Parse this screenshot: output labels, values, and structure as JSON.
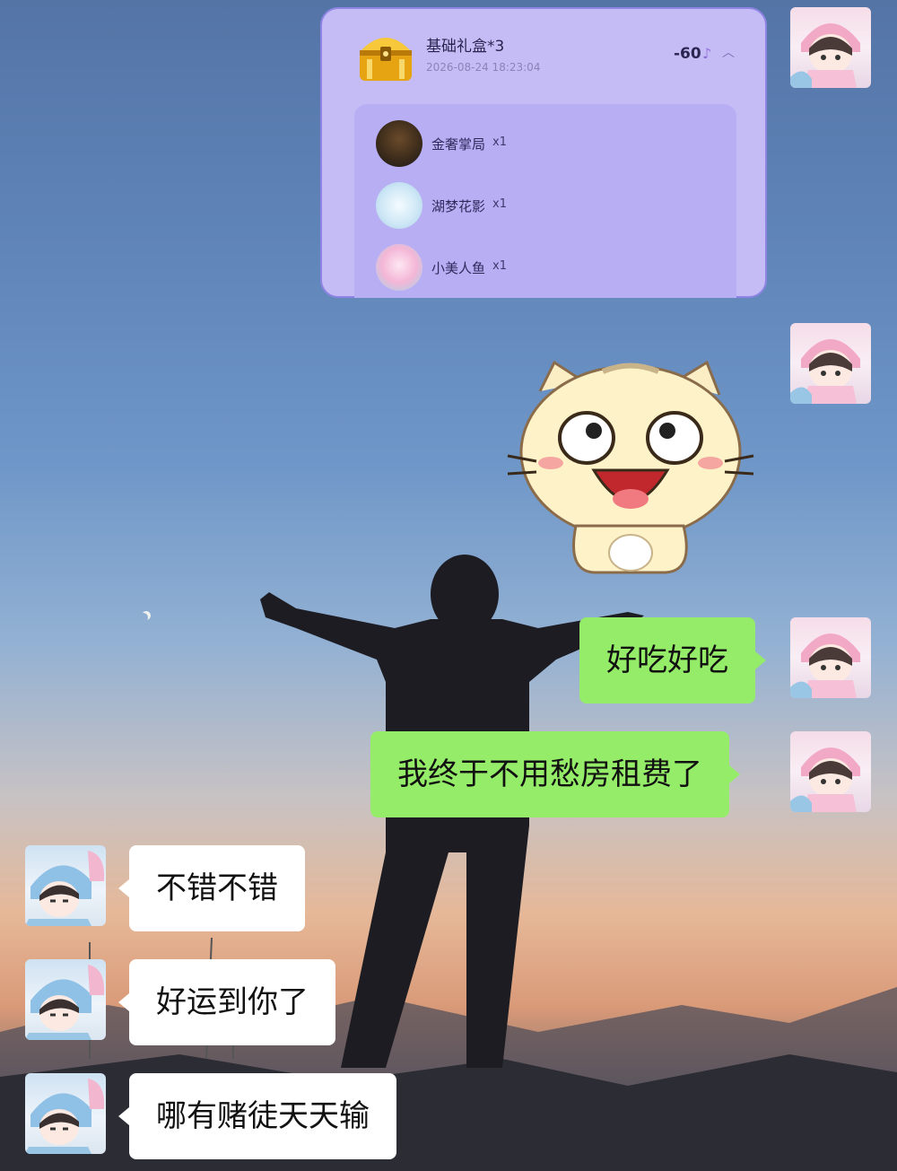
{
  "gift_card": {
    "title": "基础礼盒*3",
    "timestamp": "2026-08-24 18:23:04",
    "cost": "-60",
    "icon": "treasure-chest-icon",
    "items": [
      {
        "name": "金奢掌局",
        "qty": "x1"
      },
      {
        "name": "湖梦花影",
        "qty": "x1"
      },
      {
        "name": "小美人鱼",
        "qty": "x1"
      }
    ]
  },
  "sticker": "cat-laughing-sticker",
  "messages_sent": [
    {
      "text": "好吃好吃"
    },
    {
      "text": "我终于不用愁房租费了"
    }
  ],
  "messages_received": [
    {
      "text": "不错不错"
    },
    {
      "text": "好运到你了"
    },
    {
      "text": "哪有赌徒天天输"
    }
  ],
  "colors": {
    "sent_bubble": "#95ec69",
    "received_bubble": "#ffffff",
    "gift_card_bg": "#c5bcf6",
    "gift_card_border": "#8f84e4"
  }
}
